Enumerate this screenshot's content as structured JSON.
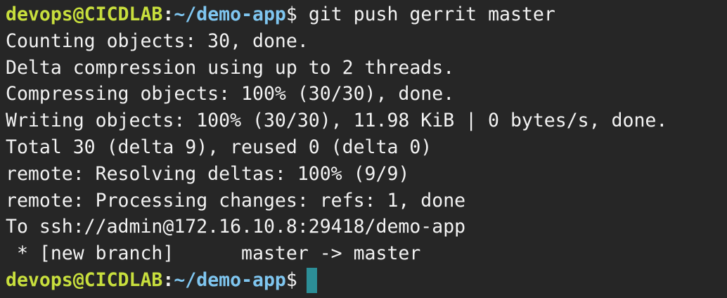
{
  "prompt": {
    "user_host": "devops@CICDLAB",
    "separator": ":",
    "path": "~/demo-app",
    "symbol": "$"
  },
  "command": " git push gerrit master",
  "output": [
    "Counting objects: 30, done.",
    "Delta compression using up to 2 threads.",
    "Compressing objects: 100% (30/30), done.",
    "Writing objects: 100% (30/30), 11.98 KiB | 0 bytes/s, done.",
    "Total 30 (delta 9), reused 0 (delta 0)",
    "remote: Resolving deltas: 100% (9/9)",
    "remote: Processing changes: refs: 1, done",
    "To ssh://admin@172.16.10.8:29418/demo-app",
    " * [new branch]      master -> master"
  ],
  "colors": {
    "background": "#262626",
    "user_host": "#c8df3d",
    "path": "#7fc6f0",
    "text": "#f2f2f2",
    "cursor": "#2c8e97"
  }
}
